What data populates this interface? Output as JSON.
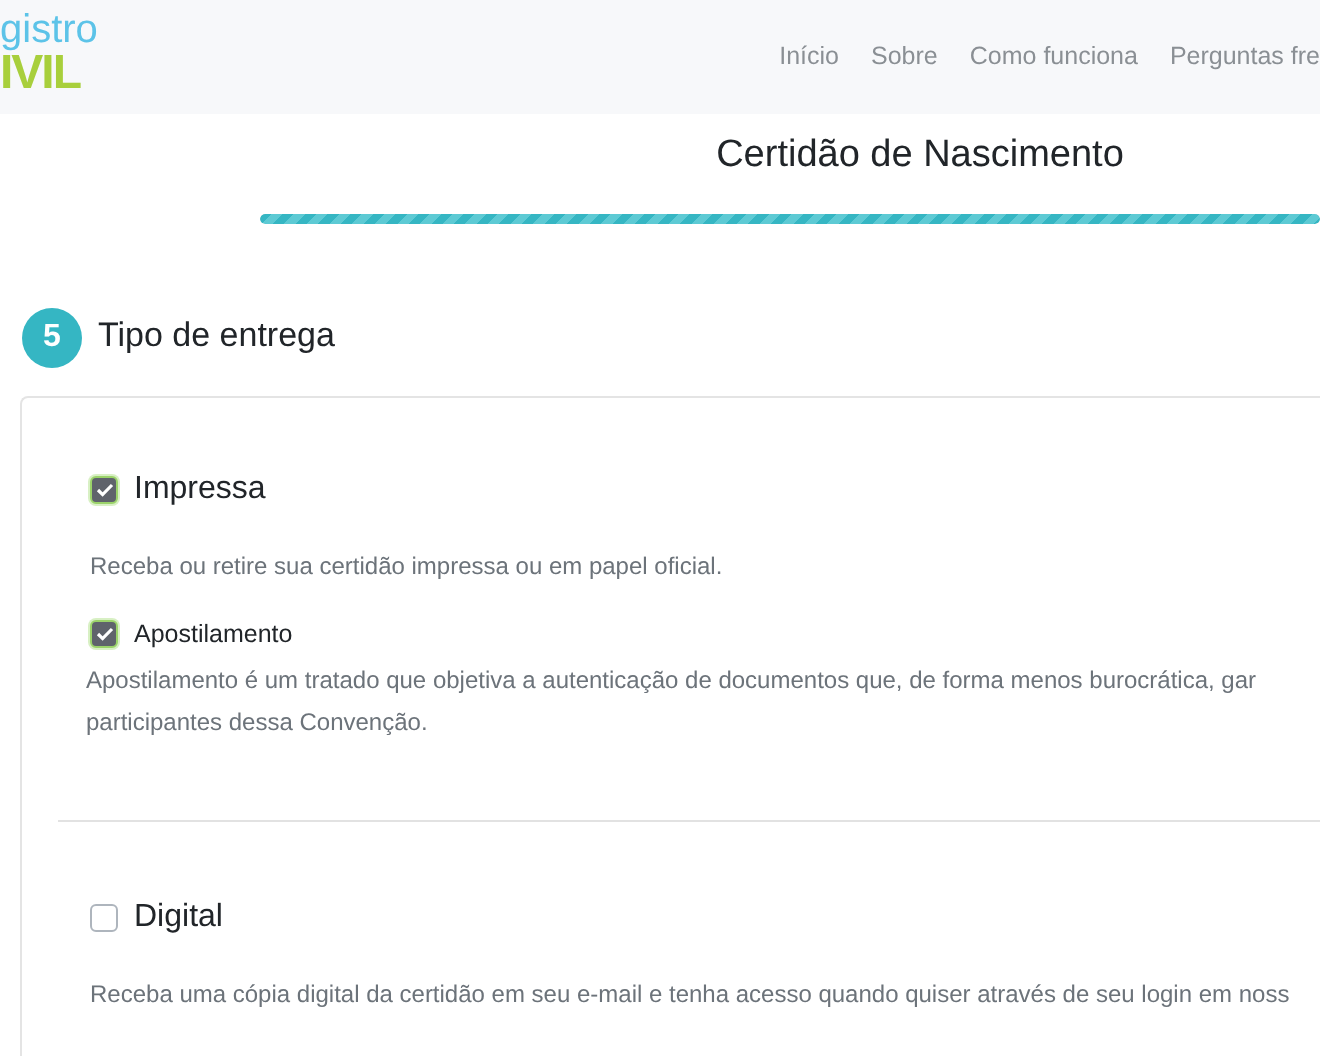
{
  "logo": {
    "top": "gistro",
    "bottom": "IVIL"
  },
  "nav": [
    {
      "label": "Início"
    },
    {
      "label": "Sobre"
    },
    {
      "label": "Como funciona"
    },
    {
      "label": "Perguntas fre"
    }
  ],
  "page_title": "Certidão de Nascimento",
  "progress": {
    "level": 1
  },
  "step": {
    "number": "5",
    "title": "Tipo de entrega"
  },
  "options": [
    {
      "kind": "main",
      "label": "Impressa",
      "checked": true,
      "description": [
        "Receba ou retire sua certidão impressa ou em papel oficial."
      ],
      "suboptions": [
        {
          "label": "Apostilamento",
          "checked": true,
          "description": [
            "Apostilamento é um tratado que objetiva a autenticação de documentos que, de forma menos burocrática, gar",
            "participantes dessa Convenção."
          ]
        }
      ]
    },
    {
      "kind": "main",
      "label": "Digital",
      "checked": false,
      "description": [
        "Receba uma cópia digital da certidão em seu e-mail e tenha acesso quando quiser através de seu login em noss"
      ]
    }
  ]
}
